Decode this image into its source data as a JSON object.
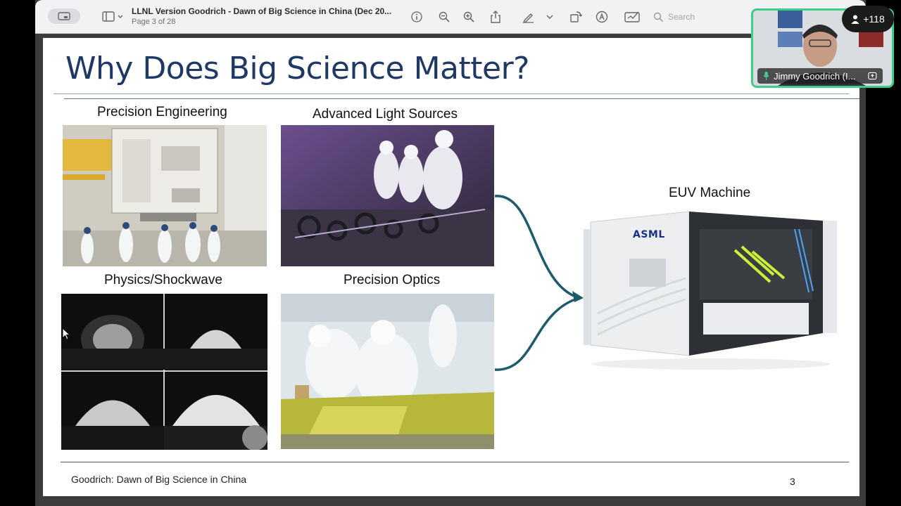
{
  "toolbar": {
    "doc_title": "LLNL Version Goodrich - Dawn of Big Science in China (Dec 20...",
    "page_indicator": "Page 3 of 28",
    "search_placeholder": "Search"
  },
  "slide": {
    "title": "Why Does Big Science Matter?",
    "captions": {
      "precision_engineering": "Precision Engineering",
      "advanced_light_sources": "Advanced Light Sources",
      "physics_shockwave": "Physics/Shockwave",
      "precision_optics": "Precision Optics",
      "euv_machine": "EUV Machine"
    },
    "asml_logo": "ASML",
    "footer": "Goodrich: Dawn of Big Science in China",
    "page_number": "3"
  },
  "video": {
    "participant_count": "+118",
    "speaker_name": "Jimmy Goodrich (I..."
  },
  "colors": {
    "title": "#1f3864",
    "arrow": "#1d5a6b",
    "active_speaker_border": "#3fce88"
  }
}
